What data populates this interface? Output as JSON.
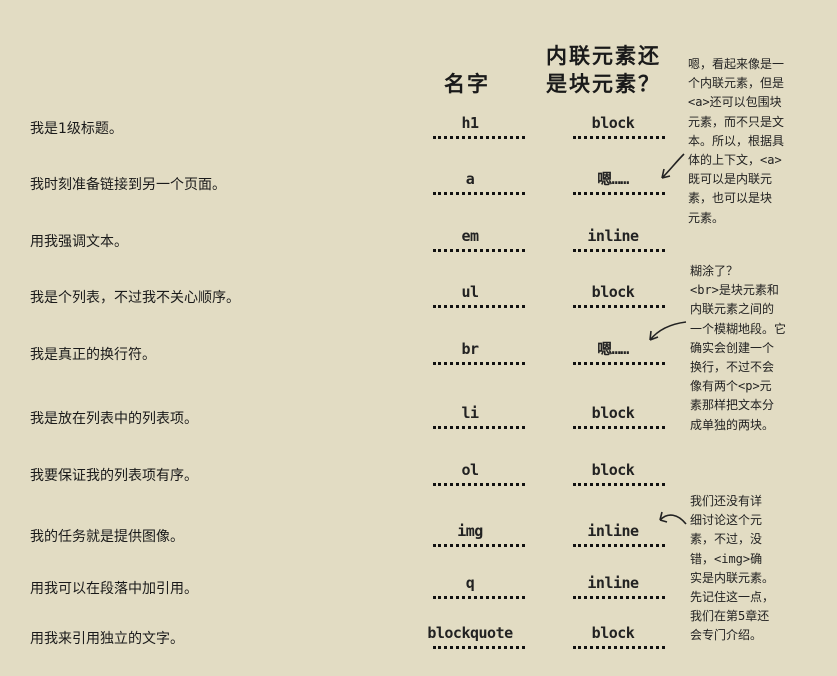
{
  "headers": {
    "name": "名字",
    "type": "内联元素还\n是块元素？"
  },
  "rows": [
    {
      "desc": "我是1级标题。",
      "name": "h1",
      "type": "block"
    },
    {
      "desc": "我时刻准备链接到另一个页面。",
      "name": "a",
      "type": "嗯……"
    },
    {
      "desc": "用我强调文本。",
      "name": "em",
      "type": "inline"
    },
    {
      "desc": "我是个列表，不过我不关心顺序。",
      "name": "ul",
      "type": "block"
    },
    {
      "desc": "我是真正的换行符。",
      "name": "br",
      "type": "嗯……"
    },
    {
      "desc": "我是放在列表中的列表项。",
      "name": "li",
      "type": "block"
    },
    {
      "desc": "我要保证我的列表项有序。",
      "name": "ol",
      "type": "block"
    },
    {
      "desc": "我的任务就是提供图像。",
      "name": "img",
      "type": "inline"
    },
    {
      "desc": "用我可以在段落中加引用。",
      "name": "q",
      "type": "inline"
    },
    {
      "desc": "用我来引用独立的文字。",
      "name": "blockquote",
      "type": "block"
    }
  ],
  "notes": {
    "a_note": "嗯，看起来像是一\n个内联元素，但是\n<a>还可以包围块\n元素，而不只是文\n本。所以，根据具\n体的上下文，<a>\n既可以是内联元\n素，也可以是块\n元素。",
    "br_note": "糊涂了？\n<br>是块元素和\n内联元素之间的\n一个模糊地段。它\n确实会创建一个\n换行，不过不会\n像有两个<p>元\n素那样把文本分\n成单独的两块。",
    "img_note": "我们还没有详\n细讨论这个元\n素，不过，没\n错，<img>确\n实是内联元素。\n先记住这一点，\n我们在第5章还\n会专门介绍。"
  }
}
